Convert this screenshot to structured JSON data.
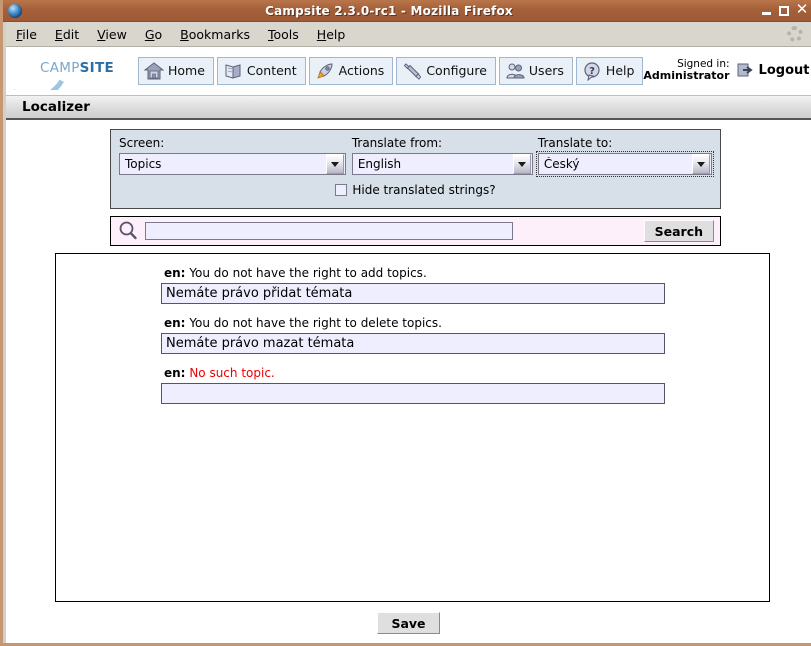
{
  "window": {
    "title": "Campsite 2.3.0-rc1 - Mozilla Firefox",
    "app_icon": "firefox-globe-icon",
    "minimize_label": "_",
    "maximize_label": "□",
    "close_label": "✕"
  },
  "menubar": {
    "items": [
      {
        "label": "File",
        "accel": "F"
      },
      {
        "label": "Edit",
        "accel": "E"
      },
      {
        "label": "View",
        "accel": "V"
      },
      {
        "label": "Go",
        "accel": "G"
      },
      {
        "label": "Bookmarks",
        "accel": "B"
      },
      {
        "label": "Tools",
        "accel": "T"
      },
      {
        "label": "Help",
        "accel": "H"
      }
    ],
    "throbber": "throbber-icon"
  },
  "brand": {
    "name_light": "CAMP",
    "name_bold": "SITE",
    "logo_icon": "campsite-swoosh-logo"
  },
  "nav": {
    "items": [
      {
        "label": "Home",
        "icon": "house-icon"
      },
      {
        "label": "Content",
        "icon": "book-icon"
      },
      {
        "label": "Actions",
        "icon": "rocket-icon"
      },
      {
        "label": "Configure",
        "icon": "wrench-icon"
      },
      {
        "label": "Users",
        "icon": "people-icon"
      },
      {
        "label": "Help",
        "icon": "question-bubble-icon"
      }
    ]
  },
  "account": {
    "signed_in_label": "Signed in:",
    "user": "Administrator",
    "logout_label": "Logout",
    "logout_icon": "logout-arrow-icon"
  },
  "page": {
    "title": "Localizer"
  },
  "filters": {
    "screen": {
      "label": "Screen:",
      "value": "Topics"
    },
    "translate_from": {
      "label": "Translate from:",
      "value": "English"
    },
    "translate_to": {
      "label": "Translate to:",
      "value": "Český",
      "focused": true
    },
    "hide_translated": {
      "label": "Hide translated strings?",
      "checked": false
    },
    "dropdown_icon": "chevron-down-icon"
  },
  "search": {
    "icon": "magnifier-icon",
    "value": "",
    "placeholder": "",
    "button_label": "Search"
  },
  "translations": {
    "source_lang_code": "en:",
    "entries": [
      {
        "source": "You do not have the right to add topics.",
        "translation": "Nemáte právo přidat témata",
        "untranslated": false
      },
      {
        "source": "You do not have the right to delete topics.",
        "translation": "Nemáte právo mazat témata",
        "untranslated": false
      },
      {
        "source": "No such topic.",
        "translation": "",
        "untranslated": true
      }
    ]
  },
  "footer": {
    "save_label": "Save"
  },
  "colors": {
    "titlebar": "#a5603a",
    "window_frame": "#c79772",
    "panel_bg": "#d7dfe8",
    "input_bg": "#eeeeff",
    "search_bg": "#fdf0fb",
    "nav_button_bg": "#e9f0f8",
    "untranslated_text": "#ee0000",
    "brand_accent": "#2d6fa3"
  }
}
